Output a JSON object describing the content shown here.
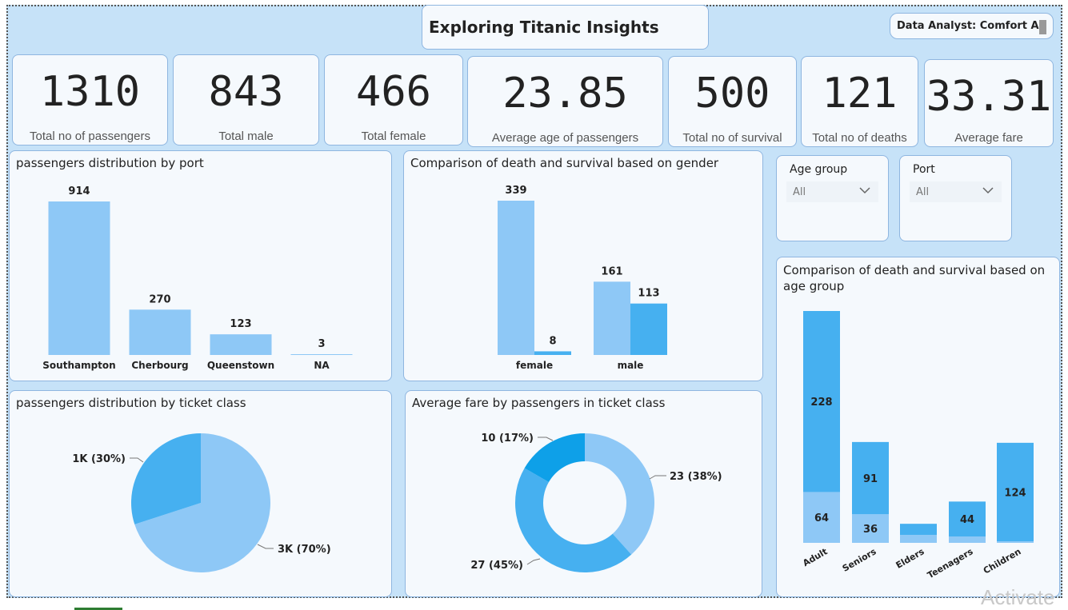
{
  "header": {
    "title": "Exploring Titanic Insights",
    "analyst": "Data Analyst: Comfort A"
  },
  "kpis": [
    {
      "value": "1310",
      "label": "Total no of passengers"
    },
    {
      "value": "843",
      "label": "Total male"
    },
    {
      "value": "466",
      "label": "Total female"
    },
    {
      "value": "23.85",
      "label": "Average age of passengers"
    },
    {
      "value": "500",
      "label": "Total no of survival"
    },
    {
      "value": "121",
      "label": "Total no of deaths"
    },
    {
      "value": "33.31",
      "label": "Average fare"
    }
  ],
  "slicers": {
    "age_group": {
      "label": "Age group",
      "value": "All"
    },
    "port": {
      "label": "Port",
      "value": "All"
    }
  },
  "colors": {
    "light_blue": "#8ec8f6",
    "mid_blue": "#46b0f0",
    "dark_blue": "#0ea0e8"
  },
  "chart_data": [
    {
      "type": "bar",
      "title": "passengers distribution by port",
      "categories": [
        "Southampton",
        "Cherbourg",
        "Queenstown",
        "NA"
      ],
      "values": [
        914,
        270,
        123,
        3
      ],
      "data_labels": [
        "914",
        "270",
        "123",
        "3"
      ]
    },
    {
      "type": "bar",
      "title": "Comparison of death and survival based on gender",
      "categories": [
        "female",
        "male"
      ],
      "series": [
        {
          "values": [
            339,
            161
          ],
          "data_labels": [
            "339",
            "161"
          ]
        },
        {
          "values": [
            8,
            113
          ],
          "data_labels": [
            "8",
            "113"
          ]
        }
      ]
    },
    {
      "type": "pie",
      "title": "passengers distribution by ticket class",
      "slices": [
        {
          "label": "1K (30%)",
          "value": 30
        },
        {
          "label": "3K (70%)",
          "value": 70
        }
      ]
    },
    {
      "type": "pie",
      "subtype": "donut",
      "title": "Average fare by passengers in ticket class",
      "slices": [
        {
          "label": "23 (38%)",
          "value": 23
        },
        {
          "label": "27 (45%)",
          "value": 27
        },
        {
          "label": "10 (17%)",
          "value": 10
        }
      ]
    },
    {
      "type": "bar",
      "subtype": "stacked",
      "title": "Comparison of death and survival based on age group",
      "categories": [
        "Adult",
        "Seniors",
        "Elders",
        "Teenagers",
        "Children"
      ],
      "series": [
        {
          "values": [
            64,
            36,
            10,
            8,
            2
          ],
          "data_labels": [
            "64",
            "36",
            "",
            "",
            ""
          ]
        },
        {
          "values": [
            228,
            91,
            14,
            44,
            124
          ],
          "data_labels": [
            "228",
            "91",
            "",
            "44",
            "124"
          ]
        }
      ]
    }
  ],
  "watermark": "Activate"
}
